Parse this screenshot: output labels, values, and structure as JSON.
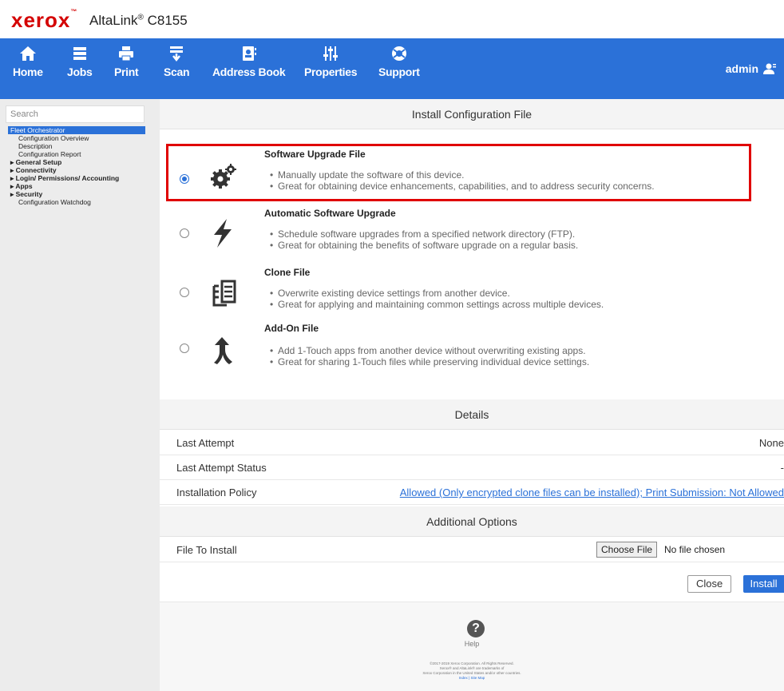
{
  "brand": {
    "logo": "xerox",
    "logo_tm": "™",
    "model_prefix": "AltaLink",
    "model_reg": "®",
    "model_suffix": " C8155"
  },
  "nav": {
    "items": [
      {
        "label": "Home",
        "icon": "home-icon"
      },
      {
        "label": "Jobs",
        "icon": "jobs-icon"
      },
      {
        "label": "Print",
        "icon": "print-icon"
      },
      {
        "label": "Scan",
        "icon": "scan-icon"
      },
      {
        "label": "Address Book",
        "icon": "address-book-icon"
      },
      {
        "label": "Properties",
        "icon": "properties-icon"
      },
      {
        "label": "Support",
        "icon": "support-icon"
      }
    ],
    "user": "admin",
    "color": "#2b71d8"
  },
  "sidebar": {
    "search_placeholder": "Search",
    "items": [
      {
        "label": "Fleet Orchestrator"
      },
      {
        "label": "Configuration Overview"
      },
      {
        "label": "Description"
      },
      {
        "label": "Configuration Report"
      },
      {
        "label": "General Setup"
      },
      {
        "label": "Connectivity"
      },
      {
        "label": "Login/ Permissions/ Accounting"
      },
      {
        "label": "Apps"
      },
      {
        "label": "Security"
      },
      {
        "label": "Configuration Watchdog"
      }
    ]
  },
  "install": {
    "title": "Install Configuration File",
    "options": [
      {
        "title": "Software Upgrade File",
        "icon": "gears-icon",
        "selected": true,
        "bullets": [
          "Manually update the software of this device.",
          "Great for obtaining device enhancements, capabilities, and to address security concerns."
        ]
      },
      {
        "title": "Automatic Software Upgrade",
        "icon": "lightning-icon",
        "selected": false,
        "bullets": [
          "Schedule software upgrades from a specified network directory (FTP).",
          "Great for obtaining the benefits of software upgrade on a regular basis."
        ]
      },
      {
        "title": "Clone File",
        "icon": "clone-document-icon",
        "selected": false,
        "bullets": [
          "Overwrite existing device settings from another device.",
          "Great for applying and maintaining common settings across multiple devices."
        ]
      },
      {
        "title": "Add-On File",
        "icon": "merge-arrow-icon",
        "selected": false,
        "bullets": [
          "Add 1-Touch apps from another device without overwriting existing apps.",
          "Great for sharing 1-Touch files while preserving individual device settings."
        ]
      }
    ],
    "highlight_color": "#e00000"
  },
  "details": {
    "title": "Details",
    "rows": [
      {
        "label": "Last Attempt",
        "value": "None"
      },
      {
        "label": "Last Attempt Status",
        "value": "-"
      },
      {
        "label": "Installation Policy",
        "value": "Allowed (Only encrypted clone files can be installed); Print Submission: Not Allowed"
      }
    ]
  },
  "additional": {
    "title": "Additional Options",
    "file_label": "File To Install",
    "choose_button": "Choose File",
    "no_file": "No file chosen"
  },
  "actions": {
    "close": "Close",
    "install": "Install"
  },
  "footer": {
    "help": "Help",
    "copyright_1": "©2017-2019 Xerox Corporation. All Rights Reserved.",
    "copyright_2": "Xerox® and AltaLink® are trademarks of",
    "copyright_3": "Xerox Corporation in the United States and/or other countries.",
    "links": "Index | Site Map"
  }
}
